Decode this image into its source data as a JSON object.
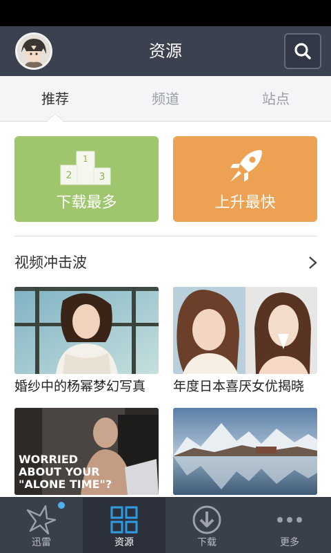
{
  "header": {
    "title": "资源",
    "avatar_icon": "user-avatar",
    "search_icon": "search-icon"
  },
  "tabs": [
    {
      "label": "推荐",
      "active": true
    },
    {
      "label": "频道",
      "active": false
    },
    {
      "label": "站点",
      "active": false
    }
  ],
  "quick_cards": [
    {
      "label": "下载最多",
      "icon": "podium-icon",
      "color": "#9fc56d",
      "podium": [
        "1",
        "2",
        "3"
      ]
    },
    {
      "label": "上升最快",
      "icon": "rocket-icon",
      "color": "#eda152"
    }
  ],
  "section": {
    "title": "视频冲击波",
    "more_icon": "chevron-right-icon"
  },
  "videos": [
    {
      "caption": "婚纱中的杨幂梦幻写真"
    },
    {
      "caption": "年度日本喜厌女优揭晓"
    },
    {
      "caption": "",
      "overlay_text": [
        "WORRIED",
        "ABOUT YOUR",
        "\"ALONE TIME\"?"
      ]
    },
    {
      "caption": ""
    }
  ],
  "bottom_nav": [
    {
      "label": "迅雷",
      "icon": "thunder-bird-icon",
      "active": false,
      "badge": true
    },
    {
      "label": "资源",
      "icon": "grid-icon",
      "active": true
    },
    {
      "label": "下载",
      "icon": "download-icon",
      "active": false
    },
    {
      "label": "更多",
      "icon": "more-dots-icon",
      "active": false
    }
  ],
  "colors": {
    "header": "#3c4150",
    "nav": "#3a3f4c",
    "green": "#9fc56d",
    "orange": "#eda152",
    "badge": "#4fb0f0"
  }
}
